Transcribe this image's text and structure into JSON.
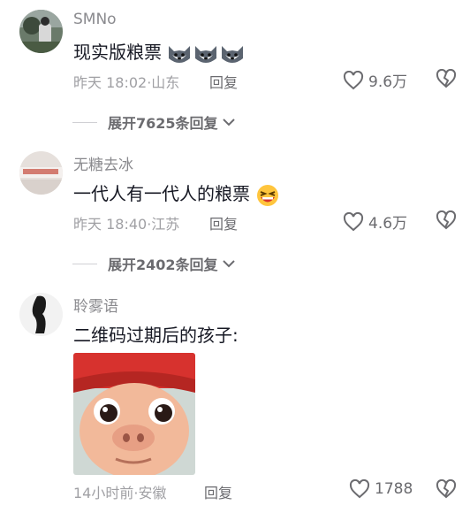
{
  "comments": [
    {
      "username": "SMNo",
      "text": "现实版粮票",
      "time": "昨天 18:02",
      "location": "山东",
      "reply_label": "回复",
      "likes": "9.6万",
      "expand_label": "展开7625条回复"
    },
    {
      "username": "无糖去冰",
      "text": "一代人有一代人的粮票",
      "time": "昨天 18:40",
      "location": "江苏",
      "reply_label": "回复",
      "likes": "4.6万",
      "expand_label": "展开2402条回复"
    },
    {
      "username": "聆雾语",
      "text": "二维码过期后的孩子:",
      "time": "14小时前",
      "location": "安徽",
      "reply_label": "回复",
      "likes": "1788"
    }
  ],
  "meta_separator": "·",
  "icons": {
    "like": "heart-outline-icon",
    "dislike": "broken-heart-icon",
    "expand": "chevron-down-icon",
    "emoji_wolf": "husky-emoji",
    "emoji_laugh": "laughing-emoji"
  },
  "colors": {
    "text": "#161823",
    "secondary": "#8a8a8e",
    "icon": "#6b6b6f"
  }
}
